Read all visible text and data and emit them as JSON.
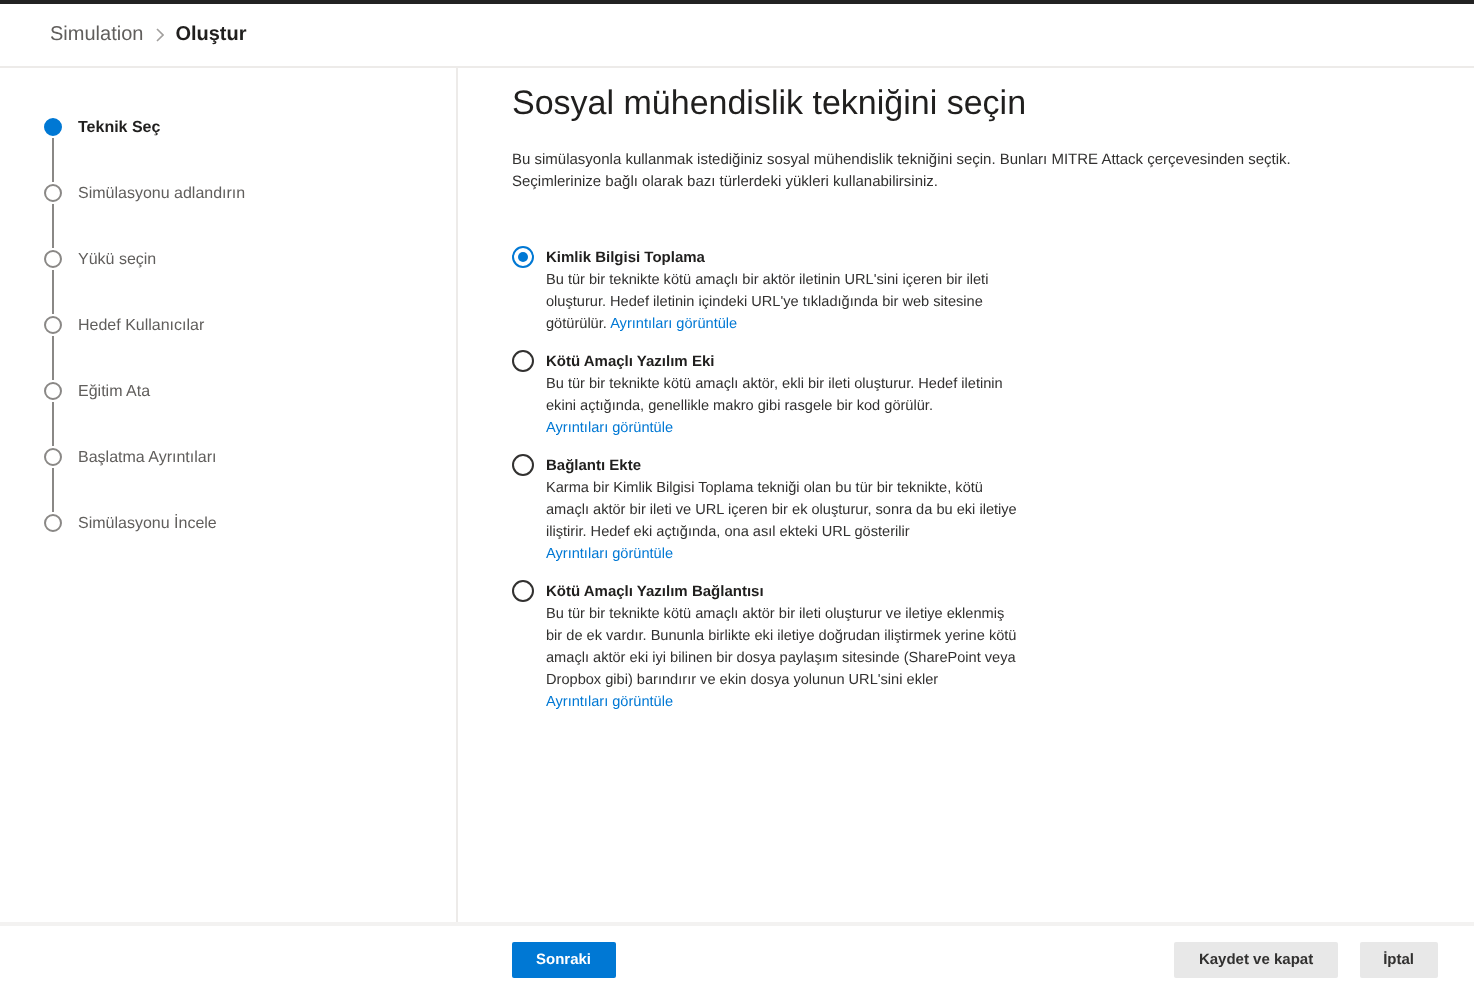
{
  "breadcrumb": [
    {
      "label": "Simulation",
      "current": false
    },
    {
      "label": "Oluştur",
      "current": true
    }
  ],
  "steps": [
    {
      "label": "Teknik Seç",
      "selected": true
    },
    {
      "label": "Simülasyonu adlandırın",
      "selected": false
    },
    {
      "label": "Yükü seçin",
      "selected": false
    },
    {
      "label": "Hedef Kullanıcılar",
      "selected": false
    },
    {
      "label": "Eğitim Ata",
      "selected": false
    },
    {
      "label": "Başlatma Ayrıntıları",
      "selected": false
    },
    {
      "label": "Simülasyonu İncele",
      "selected": false
    }
  ],
  "title": "Sosyal mühendislik tekniğini seçin",
  "description": "Bu simülasyonla kullanmak istediğiniz sosyal mühendislik tekniğini seçin. Bunları MITRE Attack çerçevesinden seçtik. Seçimlerinize bağlı olarak bazı türlerdeki yükleri kullanabilirsiniz.",
  "options": [
    {
      "title": "Kimlik Bilgisi Toplama",
      "text": "Bu tür bir teknikte kötü amaçlı bir aktör iletinin URL'sini içeren bir ileti oluşturur. Hedef iletinin içindeki URL'ye tıkladığında bir web sitesine götürülür.",
      "link": "Ayrıntıları görüntüle",
      "selected": true
    },
    {
      "title": "Kötü Amaçlı Yazılım Eki",
      "text": "Bu tür bir teknikte kötü amaçlı aktör, ekli bir ileti oluşturur. Hedef iletinin ekini açtığında, genellikle makro gibi rasgele bir kod görülür.",
      "link": "Ayrıntıları görüntüle",
      "selected": false
    },
    {
      "title": "Bağlantı Ekte",
      "text": "Karma bir Kimlik Bilgisi Toplama tekniği olan bu tür bir teknikte, kötü amaçlı aktör bir ileti ve URL içeren bir ek oluşturur, sonra da bu eki iletiye iliştirir. Hedef eki açtığında, ona asıl ekteki URL gösterilir",
      "link": "Ayrıntıları görüntüle",
      "selected": false
    },
    {
      "title": "Kötü Amaçlı Yazılım Bağlantısı",
      "text": "Bu tür bir teknikte kötü amaçlı aktör bir ileti oluşturur ve iletiye eklenmiş bir de ek vardır. Bununla birlikte eki iletiye doğrudan iliştirmek yerine kötü amaçlı aktör eki iyi bilinen bir dosya paylaşım sitesinde (SharePoint veya Dropbox gibi) barındırır ve ekin dosya yolunun URL'sini ekler",
      "link": "Ayrıntıları görüntüle",
      "selected": false
    }
  ],
  "buttons": {
    "next": "Sonraki",
    "save": "Kaydet ve kapat",
    "cancel": "İptal"
  }
}
